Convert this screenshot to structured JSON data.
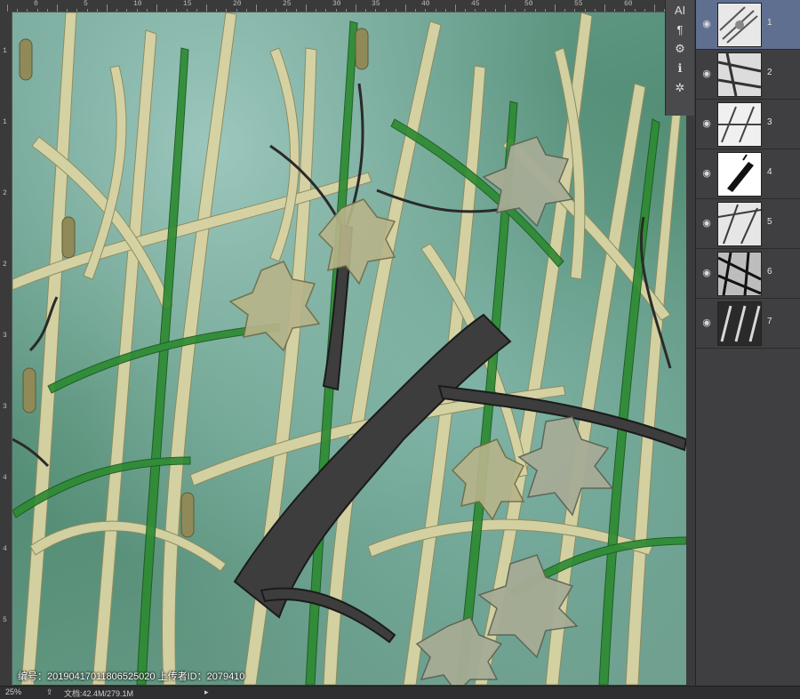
{
  "ruler": {
    "top_labels": [
      "0",
      "5",
      "10",
      "15",
      "20",
      "25",
      "30",
      "35",
      "40",
      "45",
      "50",
      "55",
      "60"
    ],
    "left_labels": [
      "1",
      "1",
      "2",
      "2",
      "3",
      "3",
      "4",
      "4",
      "5"
    ]
  },
  "tool_strip": {
    "icons": [
      "ai-icon",
      "paragraph-icon",
      "settings-icon",
      "info-icon",
      "sun-icon"
    ],
    "labels": [
      "AI",
      "¶",
      "⚙",
      "ℹ",
      "✲"
    ]
  },
  "layers": {
    "items": [
      {
        "name": "1",
        "visible": true,
        "selected": true
      },
      {
        "name": "2",
        "visible": true,
        "selected": false
      },
      {
        "name": "3",
        "visible": true,
        "selected": false
      },
      {
        "name": "4",
        "visible": true,
        "selected": false
      },
      {
        "name": "5",
        "visible": true,
        "selected": false
      },
      {
        "name": "6",
        "visible": true,
        "selected": false
      },
      {
        "name": "7",
        "visible": true,
        "selected": false
      }
    ]
  },
  "watermark": {
    "text": "编号：20190417011806525020 上传者ID：2079410"
  },
  "status": {
    "zoom": "25%",
    "doc_label": "文档:42.4M/279.1M",
    "arrow": "▸"
  },
  "colors": {
    "selected_layer": "#5f6f8f",
    "grass_light": "#d8d3a4",
    "grass_green": "#2e8a2e",
    "bark": "#3a3a3a"
  }
}
